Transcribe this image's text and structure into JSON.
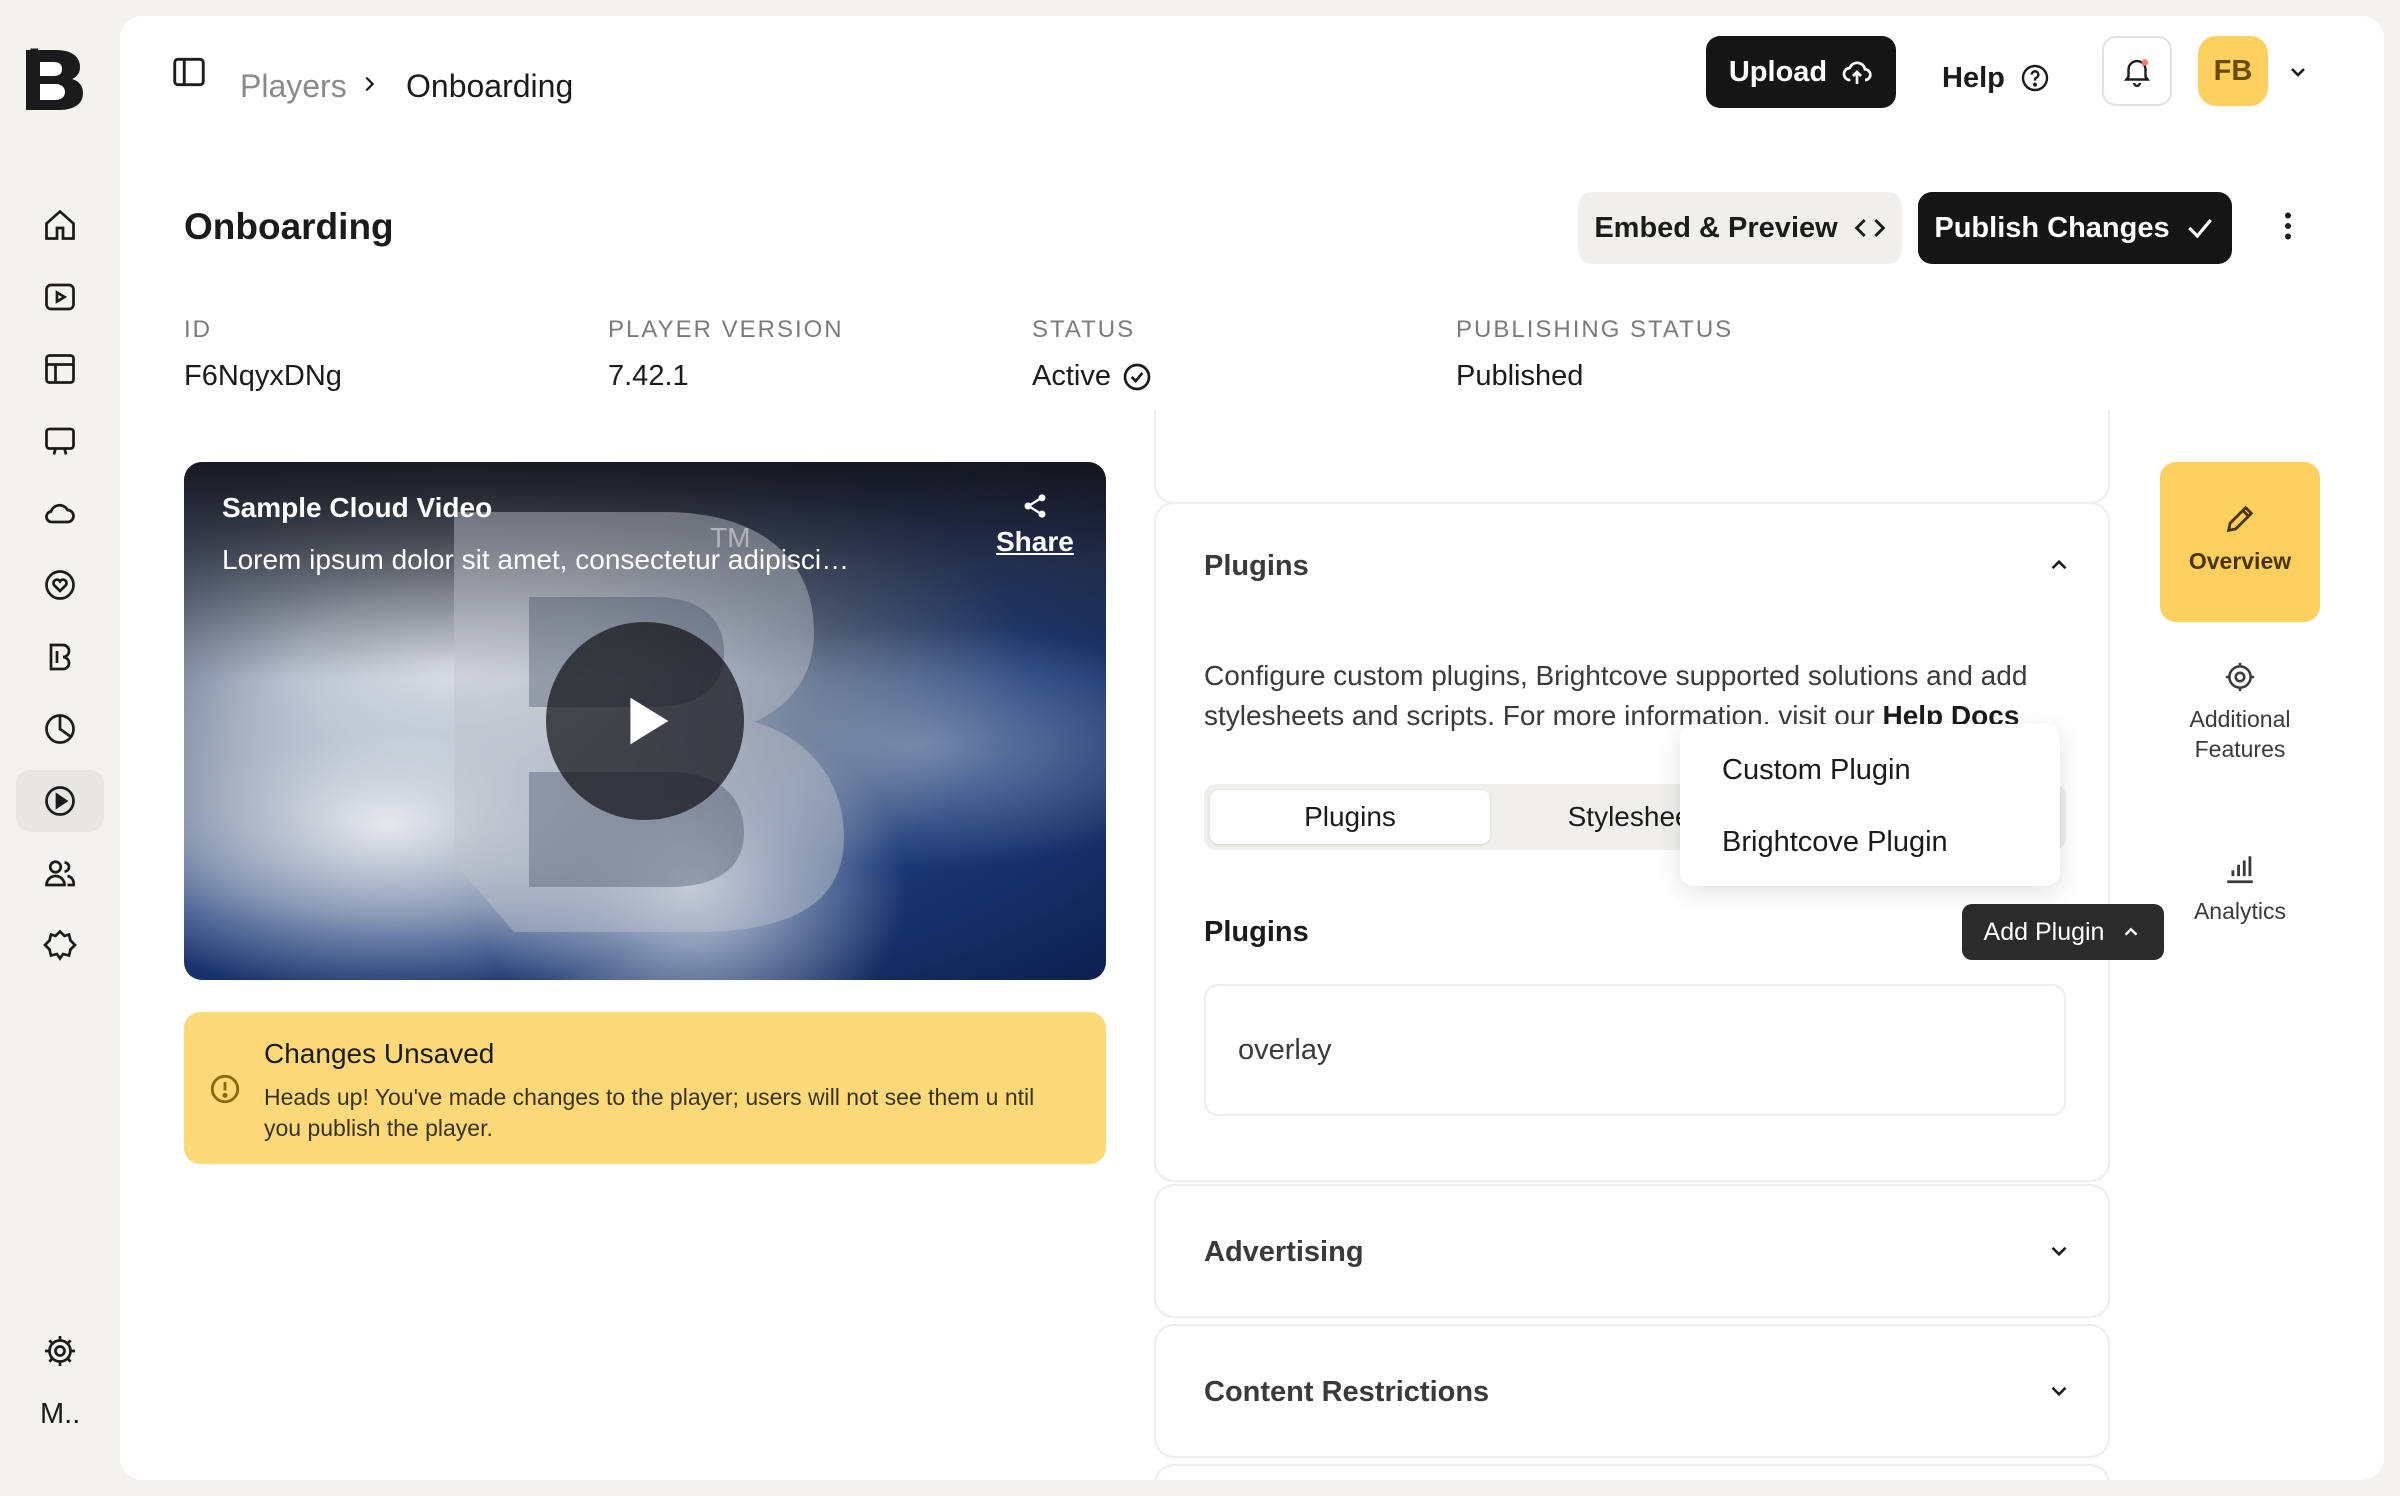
{
  "rail": {
    "items": [
      "home",
      "videos",
      "library",
      "live",
      "cloud",
      "audience",
      "brand",
      "analytics",
      "players",
      "users",
      "plugins"
    ],
    "active_index": 8,
    "user_initial": "M.."
  },
  "topbar": {
    "breadcrumb": [
      "Players",
      "Onboarding"
    ],
    "upload_label": "Upload",
    "help_label": "Help",
    "avatar_initials": "FB"
  },
  "header": {
    "title": "Onboarding",
    "embed_label": "Embed & Preview",
    "publish_label": "Publish Changes"
  },
  "meta": [
    {
      "label": "ID",
      "value": "F6NqyxDNg"
    },
    {
      "label": "PLAYER VERSION",
      "value": "7.42.1"
    },
    {
      "label": "STATUS",
      "value": "Active"
    },
    {
      "label": "PUBLISHING STATUS",
      "value": "Published"
    }
  ],
  "video": {
    "title": "Sample Cloud Video",
    "description": "Lorem ipsum dolor sit amet, consectetur adipisci…",
    "share_label": "Share",
    "tm": "TM"
  },
  "alert": {
    "title": "Changes Unsaved",
    "text": "Heads up! You've made changes to the player; users will not see them u ntil you publish the player."
  },
  "plugins_card": {
    "title": "Plugins",
    "description_prefix": "Configure custom plugins, Brightcove supported solutions and add stylesheets and scripts. For more information, visit our ",
    "description_link": "Help Docs",
    "tabs": [
      "Plugins",
      "Stylesheets"
    ],
    "section_title": "Plugins",
    "add_label": "Add Plugin",
    "items": [
      "overlay"
    ]
  },
  "dropdown": [
    "Custom Plugin",
    "Brightcove Plugin"
  ],
  "cards": [
    "Advertising",
    "Content Restrictions"
  ],
  "side_nav": [
    "Overview",
    "Additional Features",
    "Analytics"
  ],
  "colors": {
    "accent": "#fcd05f",
    "dark": "#151515",
    "alert": "#fdd97a"
  }
}
